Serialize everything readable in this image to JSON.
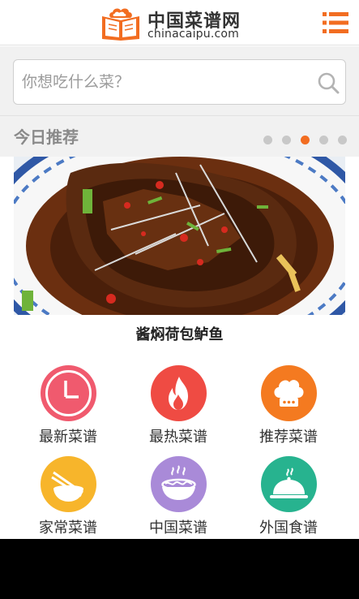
{
  "header": {
    "logo_title": "中国菜谱网",
    "logo_subtitle": "chinacaipu.com",
    "brand_color": "#f26d21"
  },
  "search": {
    "placeholder": "你想吃什么菜？"
  },
  "today": {
    "title": "今日推荐",
    "active_dot": 2,
    "dot_count": 5,
    "dish_name": "酱焖荷包鲈鱼"
  },
  "categories": [
    {
      "label": "最新菜谱",
      "icon": "clock-icon",
      "color": "#f05a6e"
    },
    {
      "label": "最热菜谱",
      "icon": "flame-icon",
      "color": "#ef4b43"
    },
    {
      "label": "推荐菜谱",
      "icon": "chef-hat-icon",
      "color": "#f47a20"
    },
    {
      "label": "家常菜谱",
      "icon": "bowl-chopsticks-icon",
      "color": "#f7b52b"
    },
    {
      "label": "中国菜谱",
      "icon": "noodle-bowl-icon",
      "color": "#a98ad8"
    },
    {
      "label": "外国食谱",
      "icon": "cloche-icon",
      "color": "#27b38f"
    }
  ]
}
